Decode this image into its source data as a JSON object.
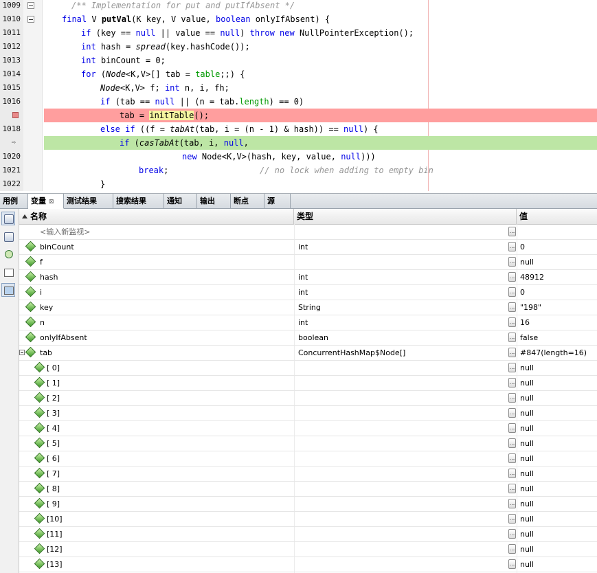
{
  "editor": {
    "lines": [
      {
        "num": "1009",
        "fold": true
      },
      {
        "num": "1010",
        "fold": true
      },
      {
        "num": "1011",
        "fold": false
      },
      {
        "num": "1012",
        "fold": false
      },
      {
        "num": "1013",
        "fold": false
      },
      {
        "num": "1014",
        "fold": false
      },
      {
        "num": "1015",
        "fold": false
      },
      {
        "num": "1016",
        "fold": false
      },
      {
        "num": "",
        "fold": false,
        "marker": "breakpoint"
      },
      {
        "num": "1018",
        "fold": false
      },
      {
        "num": "",
        "fold": false,
        "marker": "program-counter"
      },
      {
        "num": "1020",
        "fold": false
      },
      {
        "num": "1021",
        "fold": false
      },
      {
        "num": "1022",
        "fold": false
      }
    ],
    "code": {
      "l1009": "/** Implementation for put and putIfAbsent */",
      "l1010_a": "final",
      "l1010_b": " V ",
      "l1010_c": "putVal",
      "l1010_d": "(K key, V value, ",
      "l1010_e": "boolean",
      "l1010_f": " onlyIfAbsent) {",
      "l1011_a": "if",
      "l1011_b": " (key == ",
      "l1011_c": "null",
      "l1011_d": " || value == ",
      "l1011_e": "null",
      "l1011_f": ") ",
      "l1011_g": "throw",
      "l1011_h": " ",
      "l1011_i": "new",
      "l1011_j": " NullPointerException();",
      "l1012_a": "int",
      "l1012_b": " hash = ",
      "l1012_c": "spread",
      "l1012_d": "(key.hashCode());",
      "l1013_a": "int",
      "l1013_b": " binCount = 0;",
      "l1014_a": "for",
      "l1014_b": " (",
      "l1014_c": "Node",
      "l1014_d": "<K,V>[] tab = ",
      "l1014_e": "table",
      "l1014_f": ";;) {",
      "l1015_a": "Node",
      "l1015_b": "<K,V> f; ",
      "l1015_c": "int",
      "l1015_d": " n, i, fh;",
      "l1016_a": "if",
      "l1016_b": " (tab == ",
      "l1016_c": "null",
      "l1016_d": " || (n = tab.",
      "l1016_e": "length",
      "l1016_f": ") == 0)",
      "l1017_a": "tab = ",
      "l1017_b": "initTable",
      "l1017_c": "();",
      "l1018_a": "else if",
      "l1018_b": " ((f = ",
      "l1018_c": "tabAt",
      "l1018_d": "(tab, i = (n - 1) & hash)) == ",
      "l1018_e": "null",
      "l1018_f": ") {",
      "l1019_a": "if",
      "l1019_b": " (",
      "l1019_c": "casTabAt",
      "l1019_d": "(tab, i, ",
      "l1019_e": "null",
      "l1019_f": ",",
      "l1020_a": "new",
      "l1020_b": " Node<K,V>(hash, key, value, ",
      "l1020_c": "null",
      "l1020_d": ")))",
      "l1021_a": "break",
      "l1021_b": ";",
      "l1021_c": "// no lock when adding to empty bin",
      "l1022": "}"
    }
  },
  "tabs": [
    {
      "label": "用例",
      "active": false
    },
    {
      "label": "变量",
      "active": true
    },
    {
      "label": "测试结果",
      "active": false
    },
    {
      "label": "搜索结果",
      "active": false
    },
    {
      "label": "通知",
      "active": false
    },
    {
      "label": "输出",
      "active": false
    },
    {
      "label": "断点",
      "active": false
    },
    {
      "label": "源",
      "active": false
    }
  ],
  "tab_close": "⊠",
  "columns": {
    "name": "名称",
    "type": "类型",
    "value": "值"
  },
  "new_watch": "<输入新监视>",
  "value_button": "...",
  "variables": [
    {
      "name": "binCount",
      "type": "int",
      "value": "0"
    },
    {
      "name": "f",
      "type": "",
      "value": "null"
    },
    {
      "name": "hash",
      "type": "int",
      "value": "48912"
    },
    {
      "name": "i",
      "type": "int",
      "value": "0"
    },
    {
      "name": "key",
      "type": "String",
      "value": "\"198\""
    },
    {
      "name": "n",
      "type": "int",
      "value": "16"
    },
    {
      "name": "onlyIfAbsent",
      "type": "boolean",
      "value": "false"
    },
    {
      "name": "tab",
      "type": "ConcurrentHashMap$Node[]",
      "value": "#847(length=16)",
      "expanded": true
    }
  ],
  "tab_children": [
    {
      "name": "[ 0]",
      "value": "null"
    },
    {
      "name": "[ 1]",
      "value": "null"
    },
    {
      "name": "[ 2]",
      "value": "null"
    },
    {
      "name": "[ 3]",
      "value": "null"
    },
    {
      "name": "[ 4]",
      "value": "null"
    },
    {
      "name": "[ 5]",
      "value": "null"
    },
    {
      "name": "[ 6]",
      "value": "null"
    },
    {
      "name": "[ 7]",
      "value": "null"
    },
    {
      "name": "[ 8]",
      "value": "null"
    },
    {
      "name": "[ 9]",
      "value": "null"
    },
    {
      "name": "[10]",
      "value": "null"
    },
    {
      "name": "[11]",
      "value": "null"
    },
    {
      "name": "[12]",
      "value": "null"
    },
    {
      "name": "[13]",
      "value": "null"
    }
  ]
}
